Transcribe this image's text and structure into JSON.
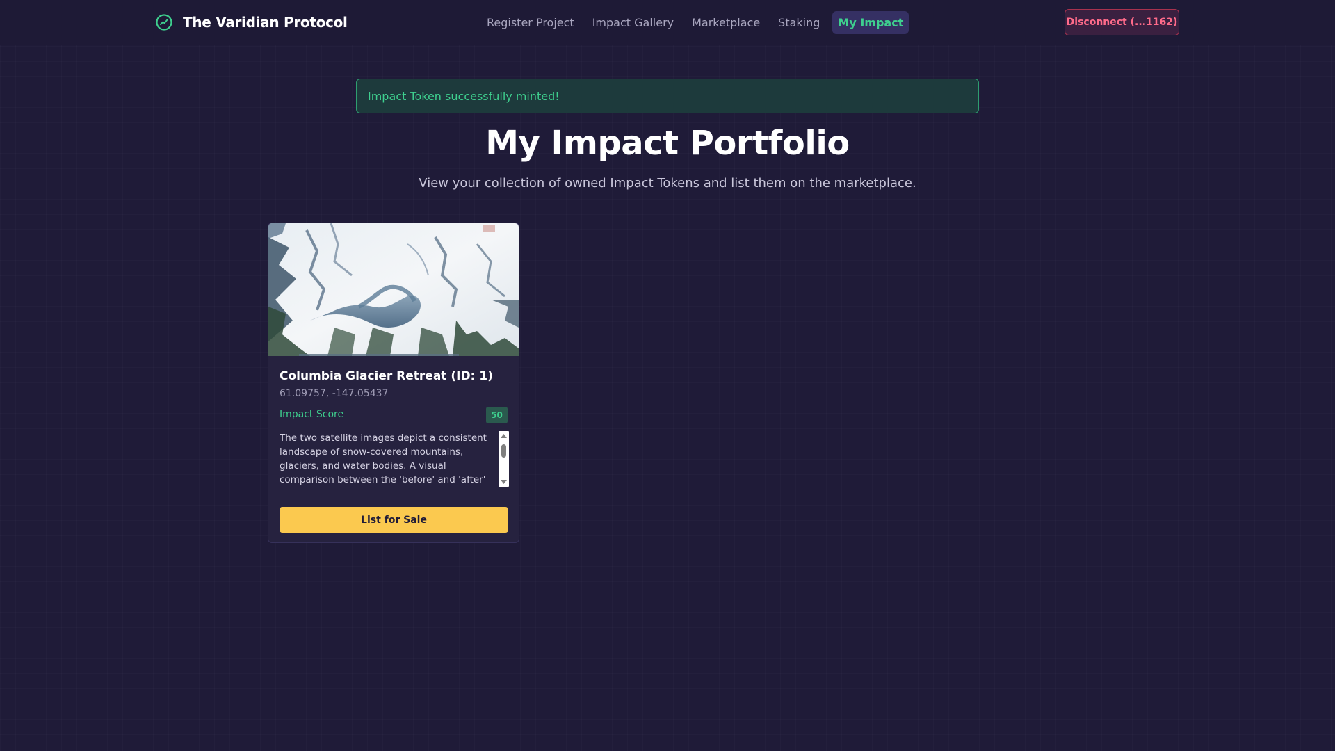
{
  "header": {
    "brand_name": "The Varidian Protocol",
    "brand_icon": "trend-chart-icon",
    "nav": [
      {
        "label": "Register Project",
        "active": false
      },
      {
        "label": "Impact Gallery",
        "active": false
      },
      {
        "label": "Marketplace",
        "active": false
      },
      {
        "label": "Staking",
        "active": false
      },
      {
        "label": "My Impact",
        "active": true
      }
    ],
    "disconnect_label": "Disconnect (...1162)"
  },
  "alert": {
    "message": "Impact Token successfully minted!"
  },
  "page": {
    "title": "My Impact Portfolio",
    "subtitle": "View your collection of owned Impact Tokens and list them on the marketplace."
  },
  "cards": [
    {
      "title": "Columbia Glacier Retreat (ID: 1)",
      "coordinates": "61.09757, -147.05437",
      "score_label": "Impact Score",
      "score_value": "50",
      "description": "The two satellite images depict a consistent landscape of snow-covered mountains, glaciers, and water bodies. A visual comparison between the 'before' and 'after'",
      "button_label": "List for Sale"
    }
  ],
  "colors": {
    "background": "#1f1b38",
    "accent_green": "#3ecf8e",
    "accent_yellow": "#fbc94f",
    "danger": "#ff6b8a"
  }
}
